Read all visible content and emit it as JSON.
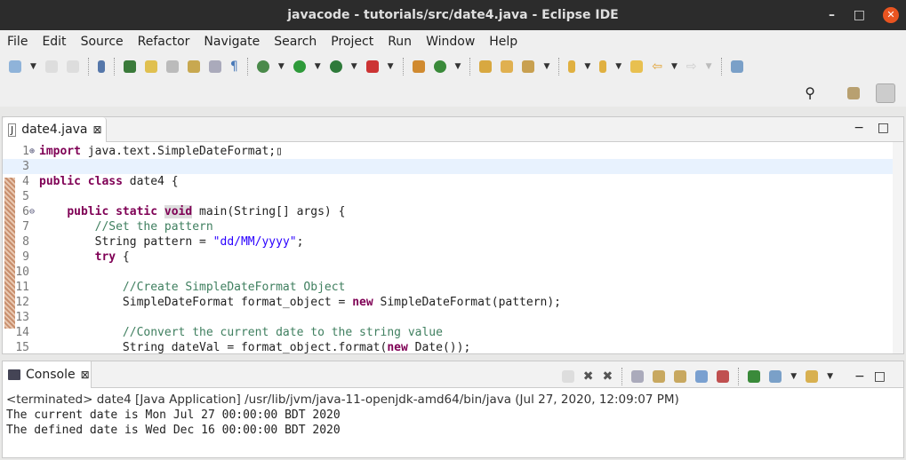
{
  "window": {
    "title": "javacode - tutorials/src/date4.java - Eclipse IDE",
    "minimize": "–",
    "maximize": "□",
    "close": "✕"
  },
  "menu": [
    "File",
    "Edit",
    "Source",
    "Refactor",
    "Navigate",
    "Search",
    "Project",
    "Run",
    "Window",
    "Help"
  ],
  "editor": {
    "tab_label": "date4.java",
    "tab_close": "⊠",
    "lines": [
      {
        "n": "1",
        "html": "<span class='kw'>import</span> java.text.SimpleDateFormat;▯",
        "marker": "⊕"
      },
      {
        "n": "3",
        "html": "",
        "hl": true
      },
      {
        "n": "4",
        "html": "<span class='kw'>public class</span> date4 {"
      },
      {
        "n": "5",
        "html": ""
      },
      {
        "n": "6",
        "html": "    <span class='kw'>public static</span> <span class='kw' style='background:#ddd'>void</span> main(String[] args) {",
        "marker": "⊖"
      },
      {
        "n": "7",
        "html": "        <span class='cm'>//Set the pattern</span>"
      },
      {
        "n": "8",
        "html": "        String pattern = <span class='st'>\"dd/MM/yyyy\"</span>;"
      },
      {
        "n": "9",
        "html": "        <span class='kw'>try</span> {"
      },
      {
        "n": "10",
        "html": ""
      },
      {
        "n": "11",
        "html": "            <span class='cm'>//Create SimpleDateFormat Object</span>"
      },
      {
        "n": "12",
        "html": "            SimpleDateFormat format_object = <span class='kw'>new</span> SimpleDateFormat(pattern);"
      },
      {
        "n": "13",
        "html": ""
      },
      {
        "n": "14",
        "html": "            <span class='cm'>//Convert the current date to the string value</span>"
      },
      {
        "n": "15",
        "html": "            String dateVal = format_object.format(<span class='kw'>new</span> Date());"
      }
    ]
  },
  "console": {
    "tab_label": "Console",
    "tab_close": "⊠",
    "status": "<terminated> date4 [Java Application] /usr/lib/jvm/java-11-openjdk-amd64/bin/java (Jul 27, 2020, 12:09:07 PM)",
    "output": [
      "The current date is Mon Jul 27 00:00:00 BDT 2020",
      "The defined date is Wed Dec 16 00:00:00 BDT 2020"
    ]
  }
}
